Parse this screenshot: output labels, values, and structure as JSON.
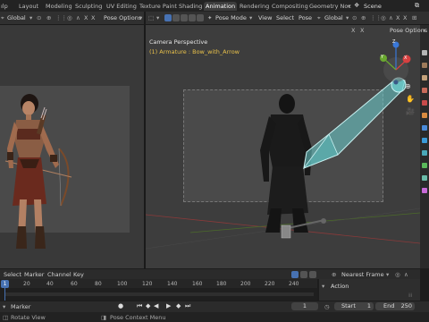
{
  "topbar": {
    "partial_left": "ılp",
    "tabs": [
      "Layout",
      "Modeling",
      "Sculpting",
      "UV Editing",
      "Texture Paint",
      "Shading",
      "Animation",
      "Rendering",
      "Compositing",
      "Geometry Noc"
    ],
    "active_tab": "Animation",
    "scene_label": "Scene"
  },
  "left_header": {
    "orientation": "Global",
    "pose_options": "Pose Options"
  },
  "right_header": {
    "mode": "Pose Mode",
    "menus": [
      "View",
      "Select",
      "Pose"
    ],
    "orientation": "Global",
    "pose_options": "Pose Options"
  },
  "viewport": {
    "camera_label": "Camera Perspective",
    "object_label": "(1) Armature : Bow_with_Arrow",
    "gizmo_axes": [
      "X",
      "Y",
      "Z"
    ]
  },
  "timeline": {
    "menus": [
      "Select",
      "Marker",
      "Channel",
      "Key"
    ],
    "snap": "Nearest Frame",
    "current_frame": "1",
    "ticks": [
      "20",
      "40",
      "60",
      "80",
      "100",
      "120",
      "140",
      "160",
      "180",
      "200",
      "220",
      "240"
    ],
    "marker_label": "Marker",
    "action_label": "Action"
  },
  "playback": {
    "frame": "1",
    "start_label": "Start",
    "start": "1",
    "end_label": "End",
    "end": "250"
  },
  "status_bar": {
    "rotate_view": "Rotate View",
    "pose_context": "Pose Context Menu"
  },
  "colors": {
    "accent": "#4772b3",
    "bone": "#6fd4d4",
    "active_tab": "#3d3d3d"
  }
}
